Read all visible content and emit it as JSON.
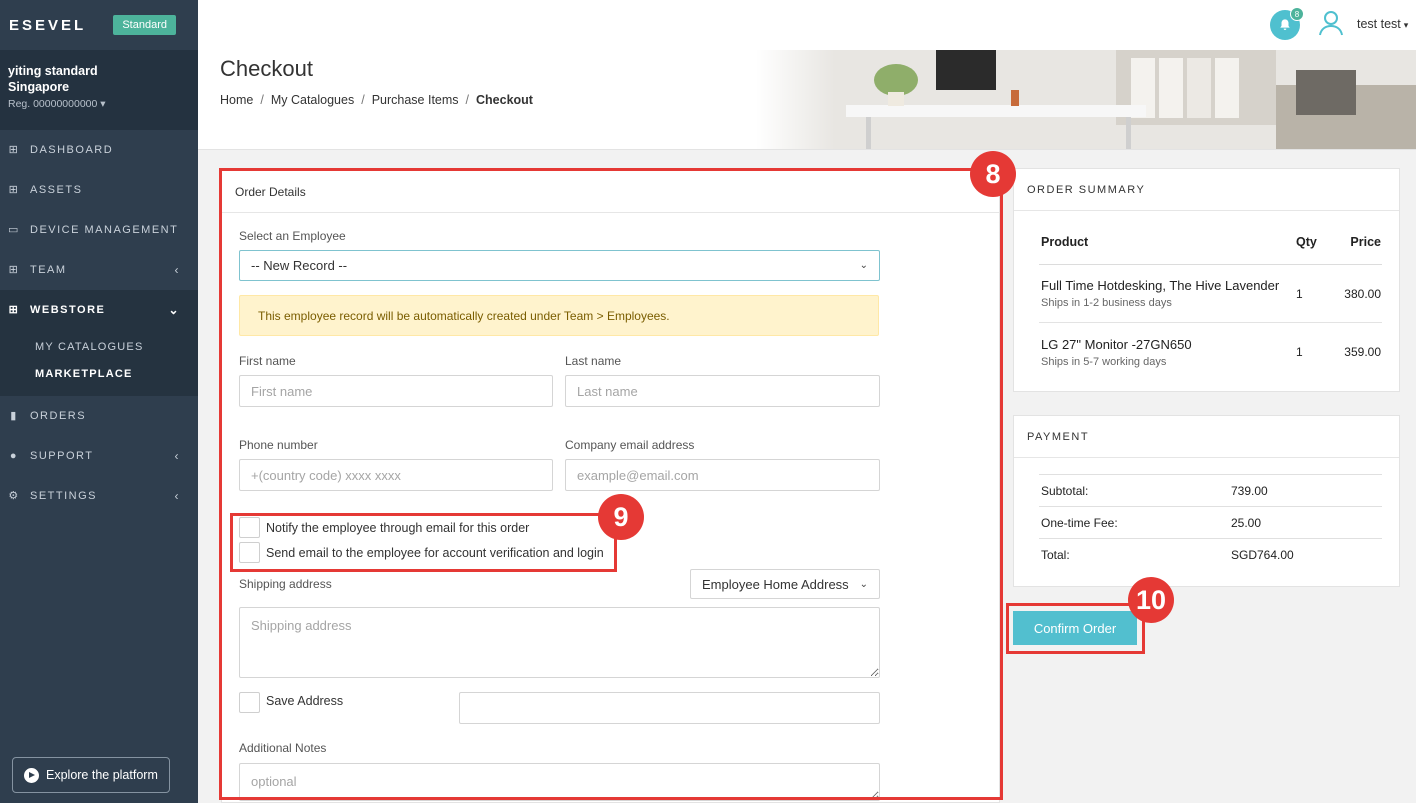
{
  "sidebar": {
    "logo": "ESEVEL",
    "plan": "Standard",
    "account_name": "yiting standard",
    "account_country": "Singapore",
    "account_reg": "Reg. 00000000000",
    "nav": {
      "dashboard": "DASHBOARD",
      "assets": "ASSETS",
      "device_management": "DEVICE MANAGEMENT",
      "team": "TEAM",
      "webstore": "WEBSTORE",
      "orders": "ORDERS",
      "support": "SUPPORT",
      "settings": "SETTINGS"
    },
    "webstore_sub": {
      "my_catalogues": "MY CATALOGUES",
      "marketplace": "MARKETPLACE"
    },
    "explore": "Explore the platform"
  },
  "topbar": {
    "notification_count": "8",
    "user_name": "test test"
  },
  "header": {
    "title": "Checkout",
    "breadcrumb": [
      "Home",
      "My Catalogues",
      "Purchase Items",
      "Checkout"
    ]
  },
  "order": {
    "title": "Order Details",
    "employee_label": "Select an Employee",
    "employee_value": "-- New Record --",
    "alert": "This employee record will be automatically created under Team > Employees.",
    "first_name_label": "First name",
    "first_name_placeholder": "First name",
    "last_name_label": "Last name",
    "last_name_placeholder": "Last name",
    "phone_label": "Phone number",
    "phone_placeholder": "+(country code) xxxx xxxx",
    "email_label": "Company email address",
    "email_placeholder": "example@email.com",
    "notify_label": "Notify the employee through email for this order",
    "verify_label": "Send email to the employee for account verification and login",
    "shipping_label": "Shipping address",
    "shipping_select": "Employee Home Address",
    "shipping_placeholder": "Shipping address",
    "save_address_label": "Save Address",
    "notes_label": "Additional Notes",
    "notes_placeholder": "optional"
  },
  "summary": {
    "title": "ORDER SUMMARY",
    "headers": {
      "product": "Product",
      "qty": "Qty",
      "price": "Price"
    },
    "items": [
      {
        "name": "Full Time Hotdesking, The Hive Lavender",
        "ship": "Ships in 1-2 business days",
        "qty": "1",
        "price": "380.00"
      },
      {
        "name": "LG 27\" Monitor -27GN650",
        "ship": "Ships in 5-7 working days",
        "qty": "1",
        "price": "359.00"
      }
    ]
  },
  "payment": {
    "title": "PAYMENT",
    "rows": [
      {
        "label": "Subtotal:",
        "value": "739.00"
      },
      {
        "label": "One-time Fee:",
        "value": "25.00"
      },
      {
        "label": "Total:",
        "value": "SGD764.00"
      }
    ]
  },
  "confirm_label": "Confirm Order",
  "annotations": [
    "8",
    "9",
    "10"
  ],
  "colors": {
    "accent": "#52bfcf",
    "sidebar": "#2f3e4e",
    "annotation": "#e53935",
    "plan_badge": "#4db39b"
  }
}
